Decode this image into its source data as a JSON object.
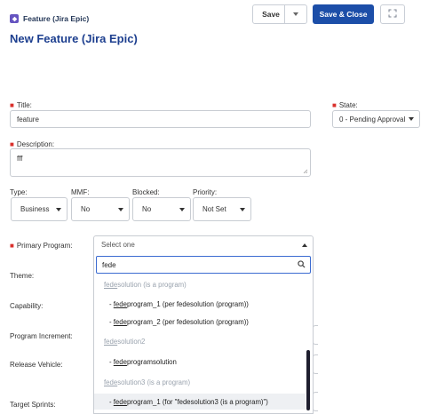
{
  "header": {
    "badge_label": "Feature (Jira Epic)",
    "page_title": "New Feature (Jira Epic)",
    "save_label": "Save",
    "save_close_label": "Save & Close"
  },
  "form": {
    "title_label": "Title:",
    "title_value": "feature",
    "state_label": "State:",
    "state_value": "0 - Pending Approval",
    "description_label": "Description:",
    "description_value": "fff",
    "type_label": "Type:",
    "type_value": "Business",
    "mmf_label": "MMF:",
    "mmf_value": "No",
    "blocked_label": "Blocked:",
    "blocked_value": "No",
    "priority_label": "Priority:",
    "priority_value": "Not Set",
    "primary_program_label": "Primary Program:",
    "primary_program_placeholder": "Select one",
    "theme_label": "Theme:",
    "capability_label": "Capability:",
    "program_increment_label": "Program Increment:",
    "release_vehicle_label": "Release Vehicle:",
    "target_sprints_label": "Target Sprints:"
  },
  "dropdown": {
    "search_value": "fede",
    "options": [
      {
        "kind": "group",
        "match": "fede",
        "rest": "solution (is a program)"
      },
      {
        "kind": "child",
        "prefix": "- ",
        "match": "fede",
        "rest": "program_1 (per fedesolution (program))"
      },
      {
        "kind": "child",
        "prefix": "- ",
        "match": "fede",
        "rest": "program_2 (per fedesolution (program))"
      },
      {
        "kind": "group",
        "match": "fede",
        "rest": "solution2"
      },
      {
        "kind": "child",
        "prefix": "- ",
        "match": "fede",
        "rest": "programsolution"
      },
      {
        "kind": "group",
        "match": "fede",
        "rest": "solution3 (is a program)"
      },
      {
        "kind": "child",
        "prefix": "- ",
        "match": "fede",
        "rest": "program_1 (for \"fedesolution3 (is a program)\")"
      }
    ]
  },
  "colors": {
    "primary_button": "#1c4ea8",
    "title_text": "#1d3f8f",
    "required_marker": "#d9302c",
    "badge": "#6554c0",
    "search_focus": "#3b6bd1"
  },
  "icons": {
    "badge": "feature-icon",
    "save_menu": "chevron-down-icon",
    "expand": "expand-icon",
    "search": "search-icon"
  }
}
